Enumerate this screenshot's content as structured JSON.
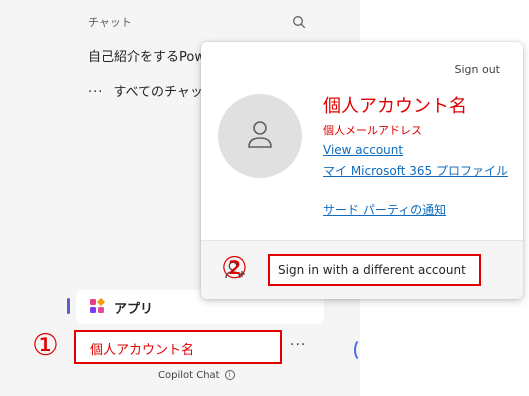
{
  "sidebar": {
    "chat_header": "チャット",
    "chat_item": "自己紹介をするPow",
    "all_chats": "すべてのチャッ",
    "apps_label": "アプリ",
    "account_name": "個人アカウント名",
    "more_label": "···",
    "footer_text": "Copilot Chat",
    "info_glyph": "i"
  },
  "badges": {
    "step1": "①",
    "step2": "②"
  },
  "popup": {
    "sign_out": "Sign out",
    "name": "個人アカウント名",
    "email": "個人メールアドレス",
    "view_account": "View account",
    "ms365_profile": "マイ Microsoft 365 プロファイル",
    "third_party": "サード パーティの通知",
    "different_account": "Sign in with a different account"
  },
  "icons": {
    "search": "search-icon",
    "ellipsis": "ellipsis-icon",
    "apps": "apps-icon",
    "more": "more-icon",
    "info": "info-icon",
    "avatar": "person-icon",
    "add_person": "add-person-icon"
  },
  "colors": {
    "annotation_red": "#e00000",
    "link_blue": "#0f6cbd",
    "sidebar_bg": "#f5f5f5",
    "accent": "#5b5fc7"
  }
}
